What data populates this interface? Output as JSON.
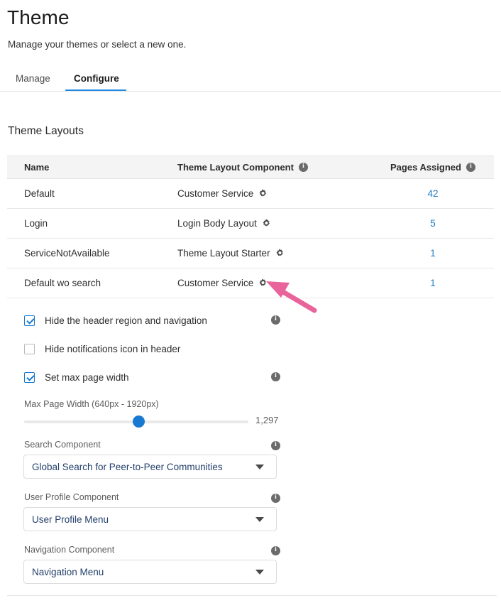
{
  "header": {
    "title": "Theme",
    "subtitle": "Manage your themes or select a new one."
  },
  "tabs": [
    {
      "label": "Manage",
      "active": false
    },
    {
      "label": "Configure",
      "active": true
    }
  ],
  "section": {
    "title": "Theme Layouts"
  },
  "table": {
    "columns": [
      {
        "label": "Name",
        "info": false
      },
      {
        "label": "Theme Layout Component",
        "info": true
      },
      {
        "label": "Pages Assigned",
        "info": true
      }
    ],
    "rows": [
      {
        "name": "Default",
        "component": "Customer Service",
        "pages": "42"
      },
      {
        "name": "Login",
        "component": "Login Body Layout",
        "pages": "5"
      },
      {
        "name": "ServiceNotAvailable",
        "component": "Theme Layout Starter",
        "pages": "1"
      },
      {
        "name": "Default wo search",
        "component": "Customer Service",
        "pages": "1"
      }
    ]
  },
  "options": {
    "checkboxes": [
      {
        "label": "Hide the header region and navigation",
        "checked": true,
        "info": true
      },
      {
        "label": "Hide notifications icon in header",
        "checked": false,
        "info": false
      },
      {
        "label": "Set max page width",
        "checked": true,
        "info": true
      }
    ],
    "slider": {
      "label": "Max Page Width (640px - 1920px)",
      "value": "1,297",
      "min": 640,
      "max": 1920,
      "percent": 51
    },
    "selects": [
      {
        "label": "Search Component",
        "value": "Global Search for Peer-to-Peer Communities",
        "info": true
      },
      {
        "label": "User Profile Component",
        "value": "User Profile Menu",
        "info": true
      },
      {
        "label": "Navigation Component",
        "value": "Navigation Menu",
        "info": true
      }
    ]
  },
  "icons": {
    "info": "i",
    "gear": "gear-icon",
    "caret": "chevron-down-icon"
  },
  "colors": {
    "accent": "#1e88e5",
    "link": "#1f7bc1",
    "select_text": "#23406b",
    "annotation_arrow": "#e8649a"
  }
}
